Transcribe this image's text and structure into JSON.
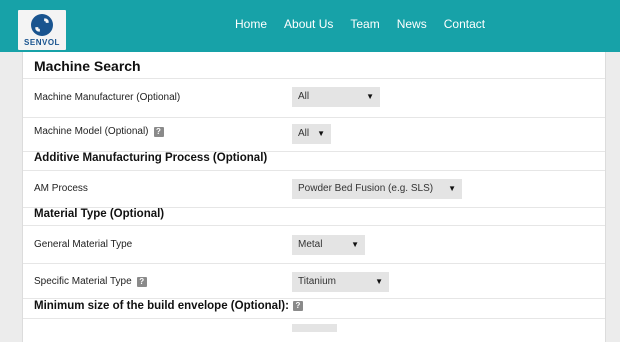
{
  "header": {
    "logo_text": "SENVOL",
    "nav": [
      "Home",
      "About Us",
      "Team",
      "News",
      "Contact"
    ]
  },
  "form": {
    "title": "Machine Search",
    "manufacturer": {
      "label": "Machine Manufacturer (Optional)",
      "value": "All"
    },
    "model": {
      "label": "Machine Model (Optional)",
      "help": "?",
      "value": "All"
    },
    "am_section": "Additive Manufacturing Process (Optional)",
    "am_process": {
      "label": "AM Process",
      "value": "Powder Bed Fusion (e.g. SLS)"
    },
    "material_section": "Material Type (Optional)",
    "general_material": {
      "label": "General Material Type",
      "value": "Metal"
    },
    "specific_material": {
      "label": "Specific Material Type",
      "help": "?",
      "value": "Titanium"
    },
    "envelope_section": "Minimum size of the build envelope (Optional):",
    "envelope_help": "?"
  },
  "icons": {
    "dropdown": "caret-down-icon",
    "help": "question-icon"
  },
  "colors": {
    "header": "#17a2a8",
    "logo": "#19548f"
  }
}
